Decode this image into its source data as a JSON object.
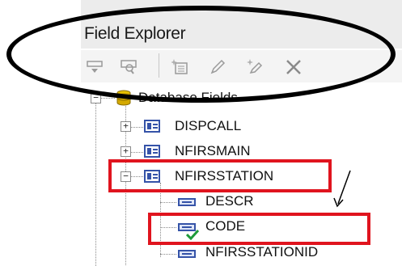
{
  "window": {
    "title": "Field Explorer"
  },
  "toolbar": {
    "buttons": [
      {
        "name": "insert-field-icon"
      },
      {
        "name": "browse-field-icon"
      },
      {
        "name": "new-field-icon"
      },
      {
        "name": "edit-field-icon"
      },
      {
        "name": "rename-field-icon"
      },
      {
        "name": "delete-field-icon"
      }
    ]
  },
  "tree": {
    "root": {
      "label": "Database Fields",
      "expander": "−"
    },
    "tables": [
      {
        "label": "DISPCALL",
        "expander": "+"
      },
      {
        "label": "NFIRSMAIN",
        "expander": "+"
      },
      {
        "label": "NFIRSSTATION",
        "expander": "−"
      }
    ],
    "fields": [
      {
        "label": "DESCR",
        "used": false
      },
      {
        "label": "CODE",
        "used": true
      },
      {
        "label": "NFIRSSTATIONID",
        "used": false
      }
    ]
  },
  "annotations": {
    "highlight_color": "#e0141e",
    "ellipse_color": "#000000"
  }
}
